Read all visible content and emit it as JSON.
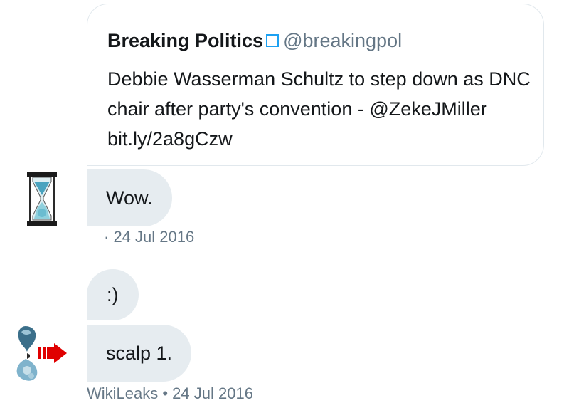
{
  "quoted_tweet": {
    "author_name": "Breaking Politics",
    "verified_icon": "verified-badge-icon",
    "handle": "@breakingpol",
    "text": "Debbie Wasserman Schultz to step down as DNC chair after party's convention - @ZekeJMiller bit.ly/2a8gCzw"
  },
  "messages": [
    {
      "text": "Wow.",
      "meta": "· 24 Jul 2016",
      "avatar": "hourglass-avatar-icon"
    },
    {
      "text": ":)"
    },
    {
      "text": "scalp 1.",
      "meta": "WikiLeaks • 24 Jul 2016",
      "avatar": "wikileaks-logo-avatar-icon"
    }
  ],
  "colors": {
    "bubble": "#e6ecf0",
    "meta_text": "#657786",
    "verified": "#1da1f2",
    "card_border": "#e1e8ed"
  }
}
